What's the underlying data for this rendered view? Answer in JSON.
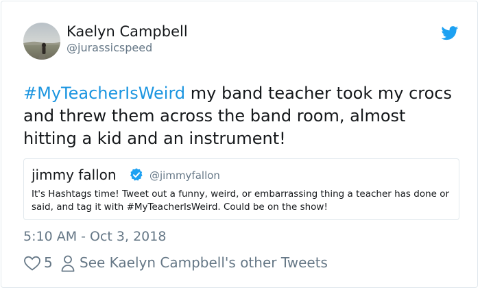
{
  "author": {
    "name": "Kaelyn Campbell",
    "handle": "@jurassicspeed"
  },
  "tweet": {
    "hashtag": "#MyTeacherIsWeird",
    "text": " my band teacher took my crocs and threw them across the band room, almost hitting a kid and an instrument!"
  },
  "quoted": {
    "name": "jimmy fallon",
    "handle": "@jimmyfallon",
    "text": "It's Hashtags time! Tweet out a funny, weird, or embarrassing thing a teacher has done or said, and tag it with #MyTeacherIsWeird. Could be on the show!"
  },
  "timestamp": "5:10 AM - Oct 3, 2018",
  "footer": {
    "likes": "5",
    "other_tweets": "See Kaelyn Campbell's other Tweets"
  },
  "colors": {
    "brand_blue": "#1da1f2",
    "link_blue": "#1b95e0",
    "muted_gray": "#657786",
    "text_dark": "#14171a",
    "border": "#e1e8ed"
  },
  "icons": [
    "twitter-bird-icon",
    "verified-badge-icon",
    "heart-icon",
    "person-icon"
  ]
}
